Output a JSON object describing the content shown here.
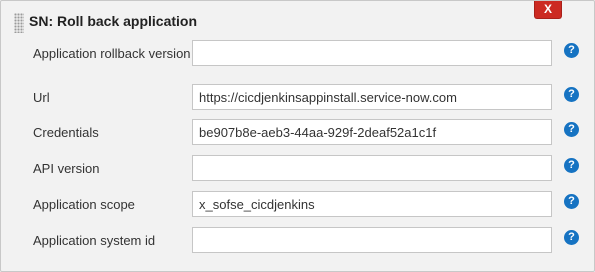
{
  "section": {
    "title": "SN: Roll back application",
    "delete_label": "X"
  },
  "help_glyph": "?",
  "fields": [
    {
      "label": "Application rollback version",
      "value": ""
    },
    {
      "label": "Url",
      "value": "https://cicdjenkinsappinstall.service-now.com"
    },
    {
      "label": "Credentials",
      "value": "be907b8e-aeb3-44aa-929f-2deaf52a1c1f"
    },
    {
      "label": "API version",
      "value": ""
    },
    {
      "label": "Application scope",
      "value": "x_sofse_cicdjenkins"
    },
    {
      "label": "Application system id",
      "value": ""
    }
  ],
  "icons": {
    "help": "help-question-icon",
    "delete": "close-x-icon",
    "drag": "drag-handle-icon"
  },
  "colors": {
    "delete_button": "#cc2a22",
    "help_icon": "#1673c2"
  }
}
